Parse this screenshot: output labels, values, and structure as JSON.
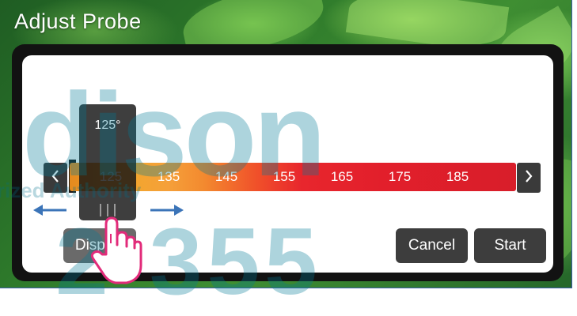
{
  "screen": {
    "title": "Adjust Probe"
  },
  "probe": {
    "selected_temp": "125°",
    "scale_labels": [
      "125",
      "135",
      "145",
      "155",
      "165",
      "175",
      "185"
    ]
  },
  "buttons": {
    "display": "Display",
    "cancel": "Cancel",
    "start": "Start"
  },
  "icons": {
    "prev": "chevron-left-icon",
    "next": "chevron-right-icon",
    "drag_left": "arrow-left-icon",
    "drag_right": "arrow-right-icon",
    "gesture": "hand-pointer-icon"
  },
  "colors": {
    "scale_low": "#e58a1e",
    "scale_high": "#d81e2a",
    "arrow": "#3b74b8",
    "hand_outline": "#e22b7a"
  }
}
